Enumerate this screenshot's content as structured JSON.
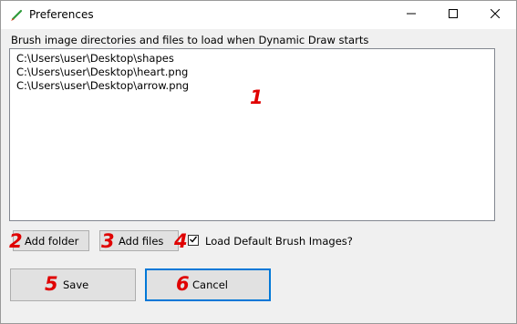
{
  "window": {
    "title": "Preferences"
  },
  "instruction": "Brush image directories and files to load when Dynamic Draw starts",
  "file_list": [
    "C:\\Users\\user\\Desktop\\shapes",
    "C:\\Users\\user\\Desktop\\heart.png",
    "C:\\Users\\user\\Desktop\\arrow.png"
  ],
  "buttons": {
    "add_folder": "Add folder",
    "add_files": "Add files",
    "save": "Save",
    "cancel": "Cancel"
  },
  "checkbox": {
    "label": "Load Default Brush Images?",
    "checked": true
  },
  "markers": [
    "1",
    "2",
    "3",
    "4",
    "5",
    "6"
  ],
  "colors": {
    "marker": "#e00000",
    "focus_border": "#0078d7"
  },
  "icons": {
    "app": "paintbrush-icon",
    "minimize": "minimize-icon",
    "maximize": "maximize-icon",
    "close": "close-icon"
  }
}
